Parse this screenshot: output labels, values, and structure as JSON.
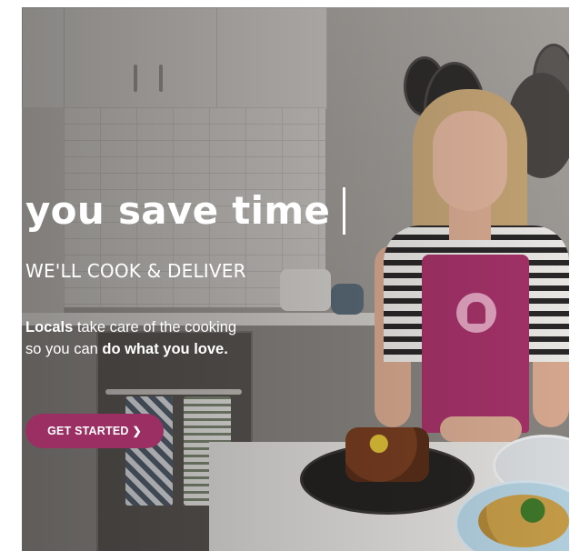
{
  "hero": {
    "headline": "you save time",
    "subheadline": "WE'LL COOK & DELIVER",
    "tagline": {
      "line1_bold": "Locals",
      "line1_rest": " take care of the cooking",
      "line2_start": "so you can ",
      "line2_bold": "do what you love."
    },
    "cta_label": "GET STARTED",
    "cta_icon": "chevron-right-icon"
  },
  "colors": {
    "accent": "#9b2f63",
    "apron": "#a8336b",
    "text": "#ffffff"
  }
}
